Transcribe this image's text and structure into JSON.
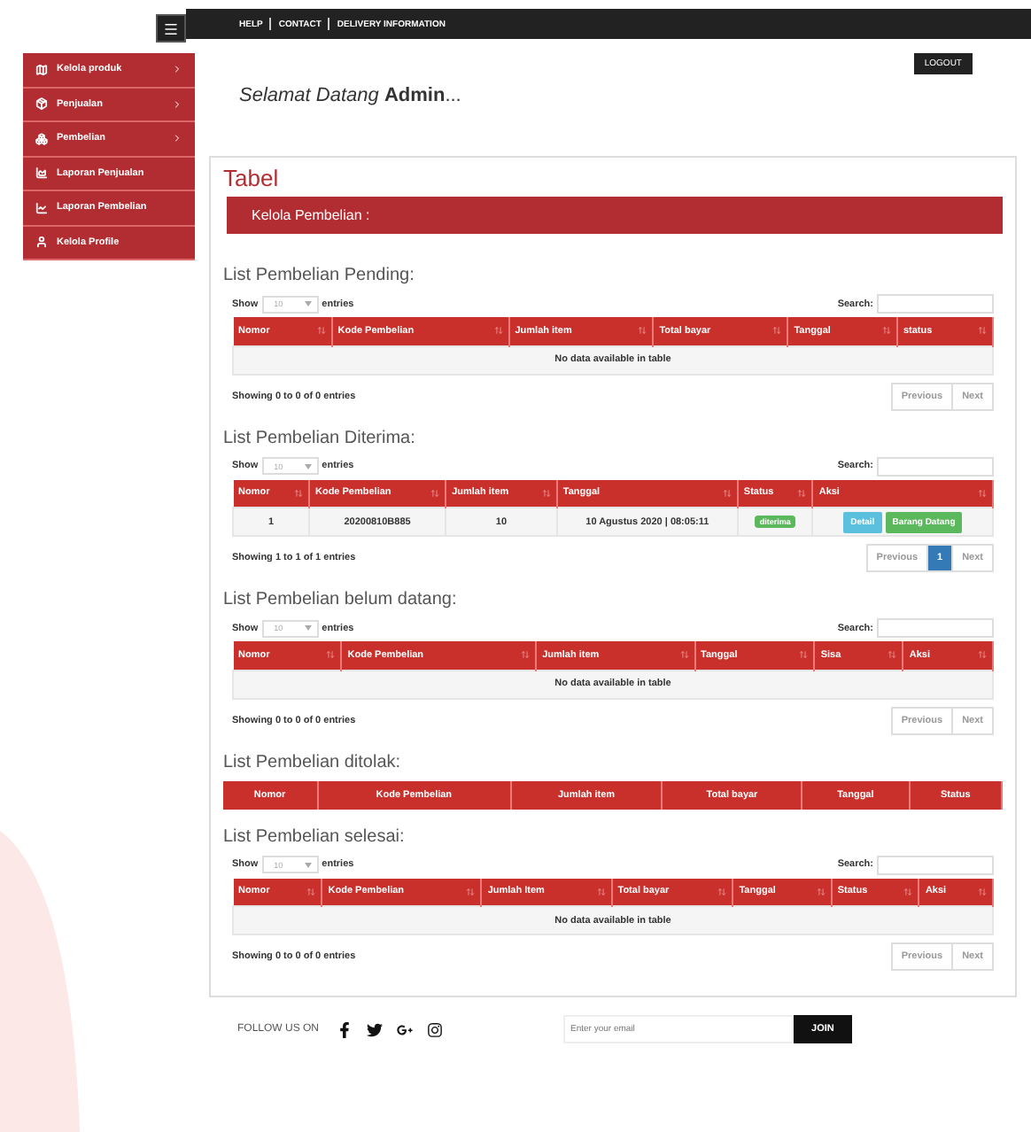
{
  "topbar": {
    "links": [
      "HELP",
      "CONTACT",
      "DELIVERY INFORMATION"
    ]
  },
  "sidebar": {
    "items": [
      {
        "label": "Kelola produk",
        "has_submenu": true
      },
      {
        "label": "Penjualan",
        "has_submenu": true
      },
      {
        "label": "Pembelian",
        "has_submenu": true
      },
      {
        "label": "Laporan Penjualan",
        "has_submenu": false
      },
      {
        "label": "Laporan Pembelian",
        "has_submenu": false
      },
      {
        "label": "Kelola Profile",
        "has_submenu": false
      }
    ]
  },
  "logout_button": "LOGOUT",
  "welcome": {
    "greeting": "Selamat Datang",
    "name": "Admin",
    "suffix": "..."
  },
  "card": {
    "title": "Tabel",
    "banner": "Kelola Pembelian :"
  },
  "tables": [
    {
      "kind": "datatable",
      "title": "List Pembelian Pending:",
      "show_label": "Show",
      "length": "10",
      "entries_label": "entries",
      "search_label": "Search:",
      "columns": [
        "Nomor",
        "Kode Pembelian",
        "Jumlah item",
        "Total bayar",
        "Tanggal",
        "status"
      ],
      "empty_message": "No data available in table",
      "info": "Showing 0 to 0 of 0 entries",
      "pages": [
        {
          "label": "Previous",
          "selected": false
        },
        {
          "label": "Next",
          "selected": false
        }
      ]
    },
    {
      "kind": "datatable",
      "title": "List Pembelian Diterima:",
      "show_label": "Show",
      "length": "10",
      "entries_label": "entries",
      "search_label": "Search:",
      "columns": [
        "Nomor",
        "Kode Pembelian",
        "Jumlah item",
        "Tanggal",
        "Status",
        "Aksi"
      ],
      "rows": [
        [
          {
            "kind": "text",
            "text": "1"
          },
          {
            "kind": "text",
            "text": "20200810B885"
          },
          {
            "kind": "text",
            "text": "10"
          },
          {
            "kind": "text",
            "text": "10 Agustus 2020 | 08:05:11"
          },
          {
            "kind": "badge",
            "text": "diterima"
          },
          {
            "kind": "actions",
            "buttons": [
              {
                "label": "Detail",
                "kind": "info"
              },
              {
                "label": "Barang Datang",
                "kind": "success"
              }
            ]
          }
        ]
      ],
      "info": "Showing 1 to 1 of 1 entries",
      "pages": [
        {
          "label": "Previous",
          "selected": false
        },
        {
          "label": "1",
          "selected": true
        },
        {
          "label": "Next",
          "selected": false
        }
      ]
    },
    {
      "kind": "datatable",
      "title": "List Pembelian belum datang:",
      "show_label": "Show",
      "length": "10",
      "entries_label": "entries",
      "search_label": "Search:",
      "columns": [
        "Nomor",
        "Kode Pembelian",
        "Jumlah item",
        "Tanggal",
        "Sisa",
        "Aksi"
      ],
      "empty_message": "No data available in table",
      "info": "Showing 0 to 0 of 0 entries",
      "pages": [
        {
          "label": "Previous",
          "selected": false
        },
        {
          "label": "Next",
          "selected": false
        }
      ]
    },
    {
      "kind": "plain",
      "title": "List Pembelian ditolak:",
      "columns": [
        "Nomor",
        "Kode Pembelian",
        "Jumlah item",
        "Total bayar",
        "Tanggal",
        "Status"
      ]
    },
    {
      "kind": "datatable",
      "title": "List Pembelian selesai:",
      "show_label": "Show",
      "length": "10",
      "entries_label": "entries",
      "search_label": "Search:",
      "columns": [
        "Nomor",
        "Kode Pembelian",
        "Jumlah Item",
        "Total bayar",
        "Tanggal",
        "Status",
        "Aksi"
      ],
      "empty_message": "No data available in table",
      "info": "Showing 0 to 0 of 0 entries",
      "pages": [
        {
          "label": "Previous",
          "selected": false
        },
        {
          "label": "Next",
          "selected": false
        }
      ]
    }
  ],
  "footer": {
    "follow_label": "FOLLOW US ON",
    "email_placeholder": "Enter your email",
    "join_button": "JOIN"
  }
}
